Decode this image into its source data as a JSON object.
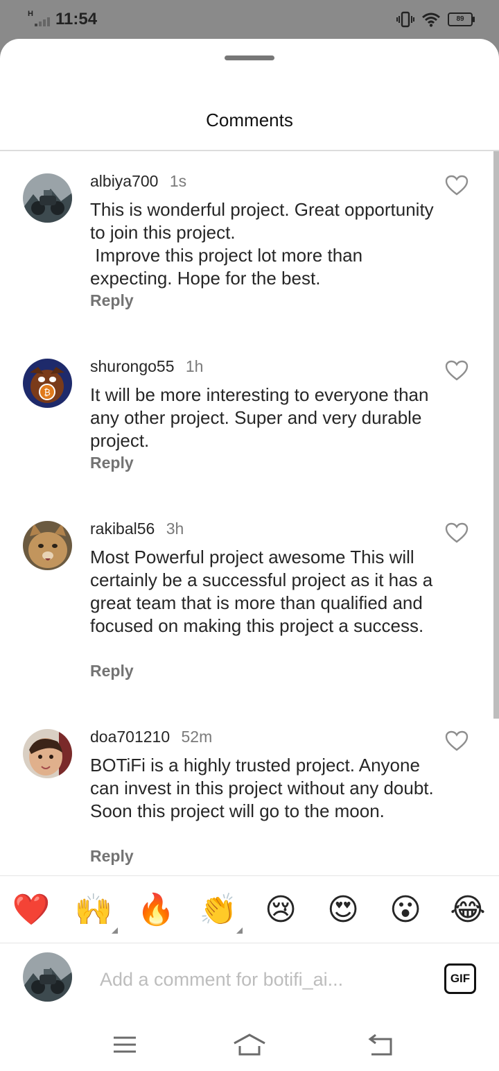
{
  "status_bar": {
    "network_type": "H",
    "time": "11:54",
    "battery_level": "89",
    "icons": [
      "signal-icon",
      "vibrate-icon",
      "wifi-icon",
      "battery-icon"
    ]
  },
  "sheet": {
    "title": "Comments"
  },
  "comments": [
    {
      "username": "albiya700",
      "time": "1s",
      "text": "This is wonderful project. Great opportunity to join this project.\n Improve this project lot more than expecting. Hope for the best.",
      "reply_label": "Reply",
      "avatar": "motorcycle-avatar"
    },
    {
      "username": "shurongo55",
      "time": "1h",
      "text": "It will be more interesting to everyone than any other project. Super and very durable project.",
      "reply_label": "Reply",
      "avatar": "cartoon-bitcoin-avatar"
    },
    {
      "username": "rakibal56",
      "time": "3h",
      "text": "Most Powerful project awesome This will certainly be a successful project as it has a great team that is more than qualified and focused on making this project a success.",
      "reply_label": "Reply",
      "avatar": "cat-avatar"
    },
    {
      "username": "doa701210",
      "time": "52m",
      "text": "BOTiFi is a highly trusted project. Anyone can invest in this project without any doubt. Soon this project will go to the moon.",
      "reply_label": "Reply",
      "avatar": "child-avatar"
    }
  ],
  "reactions": [
    "❤️",
    "🙌",
    "🔥",
    "👏",
    "😢",
    "😍",
    "😮",
    "😂"
  ],
  "composer": {
    "placeholder": "Add a comment for botifi_ai...",
    "value": "",
    "gif_label": "GIF"
  },
  "colors": {
    "status_bar_bg": "#8a8a8a",
    "text_primary": "#262626",
    "text_secondary": "#737373",
    "placeholder": "#bdbdbd"
  }
}
